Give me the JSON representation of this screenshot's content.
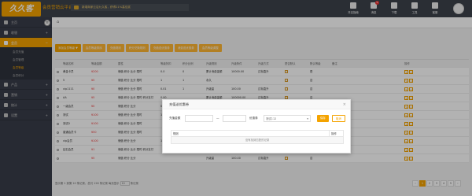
{
  "brand": {
    "logo_text": "久久客",
    "app_title": "会员营销云平台"
  },
  "notice": "新增商家云店九久客，获得21%高佳奖",
  "top_icons": [
    {
      "label": "开店指南",
      "icon": "store-icon"
    },
    {
      "label": "消息",
      "icon": "bell-icon",
      "badge": "9"
    },
    {
      "label": "下载",
      "icon": "download-icon"
    },
    {
      "label": "工具",
      "icon": "tools-icon"
    },
    {
      "label": "客服",
      "icon": "cloud-icon"
    }
  ],
  "sidebar": {
    "items": [
      {
        "label": "主页"
      },
      {
        "label": "收银"
      },
      {
        "label": "会员"
      }
    ],
    "sub_items": [
      "会员充值",
      "会员管理",
      "会员等级",
      "会员积分"
    ],
    "items2": [
      {
        "label": "产品"
      },
      {
        "label": "营销"
      },
      {
        "label": "统计"
      },
      {
        "label": "设置"
      }
    ]
  },
  "toolbar": [
    "添加会员等级 ▼",
    "会员等级排序",
    "充值规则",
    "积分兑换规则",
    "充值送优惠券",
    "消费送优惠券",
    "会员等级调整"
  ],
  "table": {
    "headers": [
      "",
      "等级名称",
      "等级金额",
      "属性",
      "等级折扣",
      "积分比例",
      "升级规则",
      "升级条件",
      "升级方式",
      "是否默认",
      "默认等级",
      "备注",
      "操作"
    ],
    "rows": [
      [
        "",
        "黄金卡员",
        "¥200",
        "储值 积分 比分 限时",
        "0.0",
        "0",
        "累计消费金额",
        "10000.00",
        "达标直升",
        "",
        "是",
        "",
        ""
      ],
      [
        "",
        "5",
        "¥5",
        "储值 积分 比分 限时",
        "1",
        "1",
        "永久",
        "",
        "",
        "",
        "否",
        "",
        ""
      ],
      [
        "",
        "vip1111",
        "¥0",
        "储值 积分 比分 限时",
        "0.01",
        "1",
        "升级量",
        "100.00",
        "达标直升",
        "",
        "否",
        "",
        ""
      ],
      [
        "",
        "AA",
        "¥5",
        "储值 积分 比分 限时 积分支付",
        "0.00",
        "",
        "累计消费金额",
        "100000.00",
        "达标直升",
        "",
        "否",
        "",
        ""
      ],
      [
        "",
        "一级会员",
        "¥0",
        "储值 积分 比分",
        "0.00",
        "",
        "累计消费金额",
        "2000.00",
        "达标直升",
        "",
        "否",
        "",
        ""
      ],
      [
        "",
        "测试",
        "¥100",
        "储值 积分 比分 限时",
        "1.00",
        "",
        "",
        "",
        "",
        "",
        "否",
        "",
        ""
      ],
      [
        "",
        "测试0",
        "¥100",
        "储值 积分 比分 限时",
        "",
        "",
        "",
        "",
        "",
        "",
        "否",
        "",
        ""
      ],
      [
        "",
        "普通会员卡",
        "¥50",
        "储值 积分 比分 限时",
        "",
        "",
        "",
        "",
        "",
        "",
        "否",
        "",
        ""
      ],
      [
        "",
        "vip会员",
        "¥100",
        "储值 积分 比分",
        "1.00",
        "",
        "",
        "",
        "",
        "",
        "否",
        "",
        ""
      ],
      [
        "",
        "钻石会员",
        "¥1",
        "储值 积分 比分 限时 积分支付",
        "",
        "",
        "",
        "",
        "",
        "",
        "否",
        "",
        ""
      ],
      [
        "",
        "",
        "¥5",
        "储值 积分 比分",
        "",
        "",
        "升级量",
        "100.00",
        "达标直升",
        "",
        "否",
        "",
        ""
      ]
    ]
  },
  "footer": {
    "summary": "显示第 1 到第 10 条记录，总共 126 条记录 每页显示",
    "page_size": "10",
    "suffix": "条记录"
  },
  "pager": [
    "‹",
    "1",
    "2",
    "3",
    "4",
    "5",
    "›"
  ],
  "modal": {
    "title": "充值送优惠券",
    "close": "×",
    "amount_label": "充值金额",
    "dash": "—",
    "coupon_label": "优惠券",
    "coupon_value": "测试112",
    "save": "保存",
    "cancel": "取消",
    "col_rule": "规则",
    "col_op": "操作",
    "empty": "没有找到匹配的记录"
  }
}
